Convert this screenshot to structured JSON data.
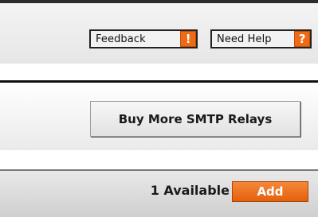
{
  "header": {
    "feedback_label": "Feedback",
    "feedback_badge": "!",
    "help_label": "Need Help",
    "help_badge": "?"
  },
  "relays": {
    "buy_label": "Buy More SMTP Relays",
    "available_text": "1 Available",
    "add_label": "Add"
  },
  "colors": {
    "accent": "#ee6a14"
  }
}
